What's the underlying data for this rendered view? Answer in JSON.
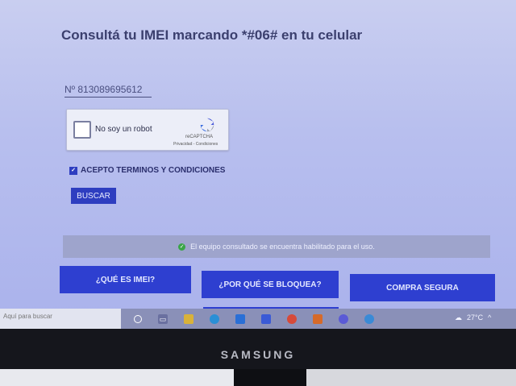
{
  "page": {
    "title": "Consultá tu IMEI marcando *#06# en tu celular",
    "imei_value": "Nº 813089695612",
    "recaptcha": {
      "label": "No soy un robot",
      "brand": "reCAPTCHA",
      "terms": "Privacidad - Condiciones"
    },
    "accept_label": "ACEPTO TERMINOS Y CONDICIONES",
    "search_button": "BUSCAR",
    "status_message": "El equipo consultado se encuentra habilitado para el uso.",
    "nav_buttons": {
      "imei": "¿QUÉ ES IMEI?",
      "bloquea": "¿POR QUÉ SE BLOQUEA?",
      "compra": "COMPRA SEGURA"
    }
  },
  "taskbar": {
    "search_placeholder": "Aquí para buscar",
    "temperature": "27°C",
    "icons": [
      "start-icon",
      "task-view-icon",
      "file-explorer-icon",
      "edge-icon",
      "store-icon",
      "mail-icon",
      "chrome-icon",
      "office-icon",
      "teams-icon",
      "app-icon"
    ]
  },
  "monitor": {
    "brand": "SAMSUNG"
  },
  "colors": {
    "accent": "#2e3ec0",
    "success": "#3aa548"
  }
}
